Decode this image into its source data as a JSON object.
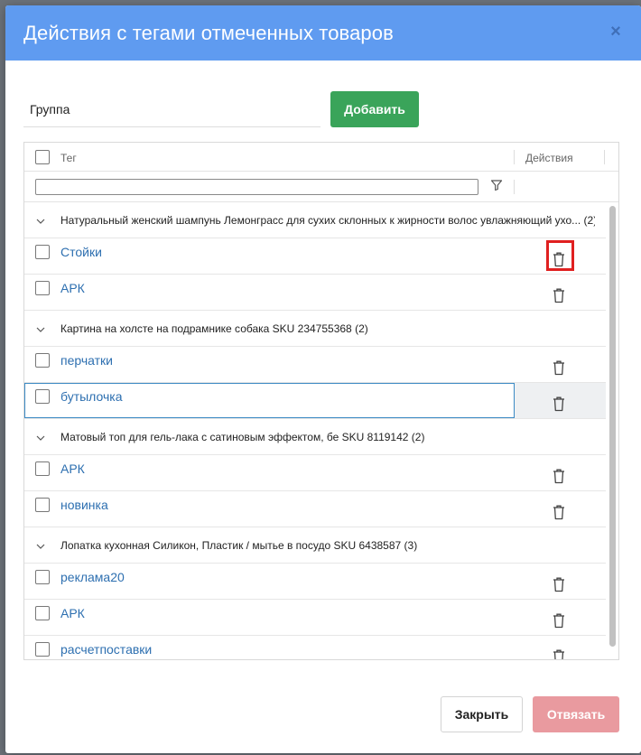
{
  "modal": {
    "title": "Действия с тегами отмеченных товаров",
    "close_glyph": "×"
  },
  "add_form": {
    "group_value": "Группа",
    "add_label": "Добавить"
  },
  "grid": {
    "col_tag": "Тег",
    "col_actions": "Действия",
    "groups": [
      {
        "title": "Натуральный женский шампунь Лемонграсс для сухих склонных к жирности волос увлажняющий ухо...",
        "count": "(2)",
        "tags": [
          "Стойки",
          "АРК"
        ]
      },
      {
        "title": "Картина на холсте на подрамнике собака SKU 234755368",
        "count": "(2)",
        "tags": [
          "перчатки",
          "бутылочка"
        ]
      },
      {
        "title": "Матовый топ для гель-лака с сатиновым эффектом, бе SKU 8119142",
        "count": "(2)",
        "tags": [
          "АРК",
          "новинка"
        ]
      },
      {
        "title": "Лопатка кухонная Силикон, Пластик / мытье в посудо SKU 6438587",
        "count": "(3)",
        "tags": [
          "реклама20",
          "АРК",
          "расчетпоставки"
        ]
      }
    ]
  },
  "footer": {
    "close_label": "Закрыть",
    "unbind_label": "Отвязать"
  },
  "colors": {
    "header": "#5f9bf0",
    "add_button": "#3aa45a",
    "unbind_button": "#e99a9f",
    "tag_link": "#2d6fb0",
    "highlight": "#e02020"
  }
}
